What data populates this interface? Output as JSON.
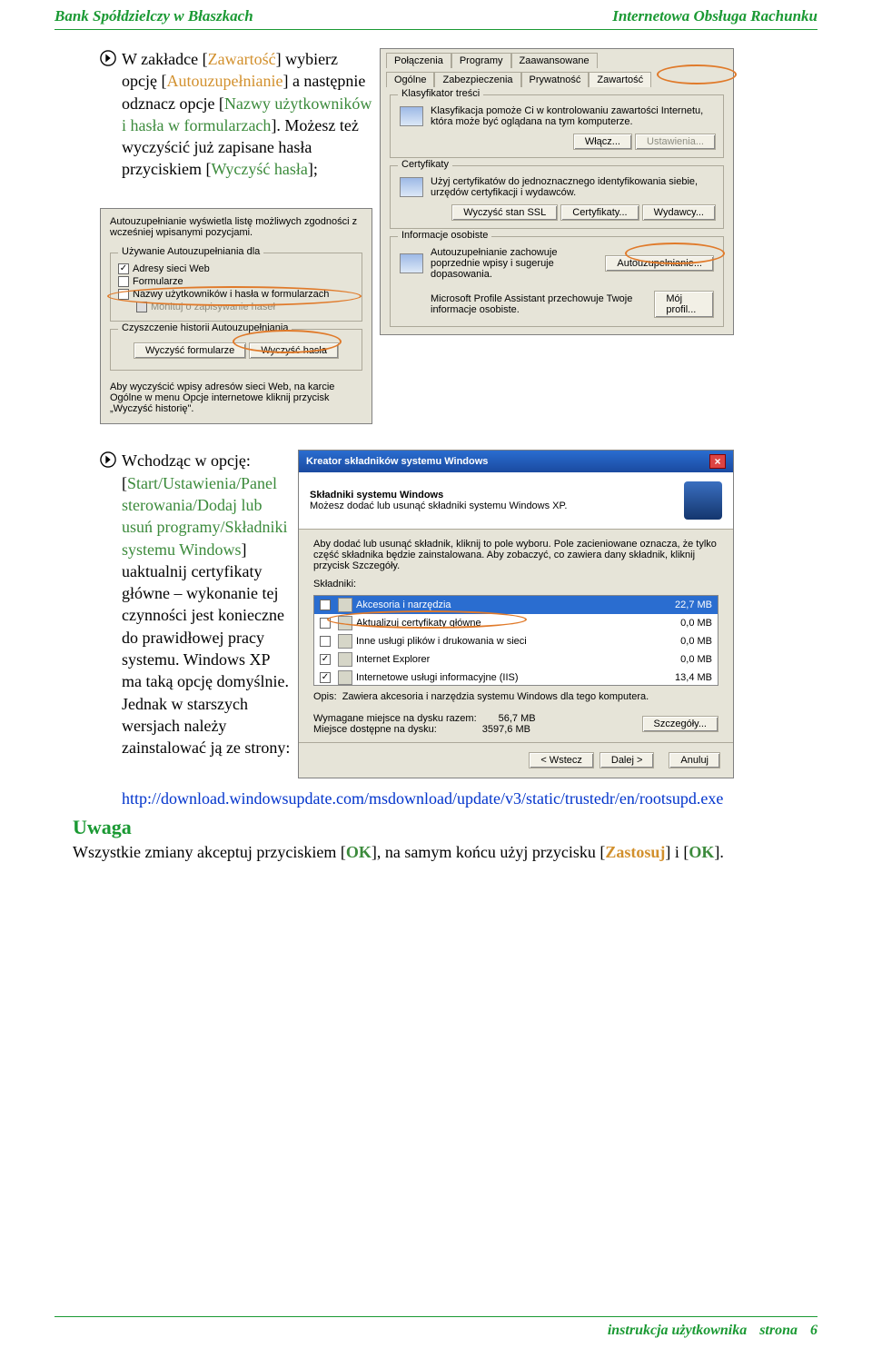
{
  "header": {
    "left": "Bank Spółdzielczy w Błaszkach",
    "right": "Internetowa Obsługa Rachunku"
  },
  "bullet1": {
    "parts": [
      {
        "t": "W zakładce [",
        "c": "#000"
      },
      {
        "t": "Zawartość",
        "c": "#d2902d"
      },
      {
        "t": "] wybierz opcję [",
        "c": "#000"
      },
      {
        "t": "Autouzupełnianie",
        "c": "#d2902d"
      },
      {
        "t": "] a następnie odznacz opcje [",
        "c": "#000"
      },
      {
        "t": "Nazwy użytkowników i hasła w formularzach",
        "c": "#3b8a3b"
      },
      {
        "t": "]. Możesz też wyczyścić już zapisane hasła przyciskiem [",
        "c": "#000"
      },
      {
        "t": "Wyczyść hasła",
        "c": "#3b8a3b"
      },
      {
        "t": "];",
        "c": "#000"
      }
    ]
  },
  "win1": {
    "tabs_bottom": [
      "Ogólne",
      "Zabezpieczenia",
      "Prywatność",
      "Zawartość"
    ],
    "tabs_top": [
      "Połączenia",
      "Programy",
      "Zaawansowane"
    ],
    "group_klas": {
      "title": "Klasyfikator treści",
      "text": "Klasyfikacja pomoże Ci w kontrolowaniu zawartości Internetu, która może być oglądana na tym komputerze.",
      "btn1": "Włącz...",
      "btn2": "Ustawienia..."
    },
    "group_cert": {
      "title": "Certyfikaty",
      "text": "Użyj certyfikatów do jednoznacznego identyfikowania siebie, urzędów certyfikacji i wydawców.",
      "b1": "Wyczyść stan SSL",
      "b2": "Certyfikaty...",
      "b3": "Wydawcy..."
    },
    "group_info": {
      "title": "Informacje osobiste",
      "text1": "Autouzupełnianie zachowuje poprzednie wpisy i sugeruje dopasowania.",
      "btn1": "Autouzupełnianie...",
      "text2": "Microsoft Profile Assistant przechowuje Twoje informacje osobiste.",
      "btn2": "Mój profil..."
    }
  },
  "win2": {
    "intro": "Autouzupełnianie wyświetla listę możliwych zgodności z wcześniej wpisanymi pozycjami.",
    "group_use": {
      "title": "Używanie Autouzupełniania dla",
      "items": [
        "Adresy sieci Web",
        "Formularze",
        "Nazwy użytkowników i hasła w formularzach",
        "Monituj o zapisywanie haseł"
      ],
      "checked": [
        true,
        false,
        false,
        false
      ]
    },
    "group_clear": {
      "title": "Czyszczenie historii Autouzupełniania",
      "b1": "Wyczyść formularze",
      "b2": "Wyczyść hasła"
    },
    "note": "Aby wyczyścić wpisy adresów sieci Web, na karcie Ogólne w menu Opcje internetowe kliknij przycisk „Wyczyść historię\"."
  },
  "bullet2": {
    "parts": [
      {
        "t": "Wchodząc w opcję: [",
        "c": "#000"
      },
      {
        "t": "Start/Ustawienia/Panel sterowania/Dodaj lub usuń programy/Składniki systemu Windows",
        "c": "#3b8a3b"
      },
      {
        "t": "] uaktualnij certyfikaty główne – wykonanie tej czynności jest konieczne do prawidłowej pracy systemu. Windows XP ma taką opcję domyślnie. Jednak w starszych wersjach należy zainstalować ją ze strony:",
        "c": "#000"
      }
    ]
  },
  "win3": {
    "title": "Kreator składników systemu Windows",
    "banner_title": "Składniki systemu Windows",
    "banner_sub": "Możesz dodać lub usunąć składniki systemu Windows XP.",
    "instr": "Aby dodać lub usunąć składnik, kliknij to pole wyboru. Pole zacieniowane oznacza, że tylko część składnika będzie zainstalowana. Aby zobaczyć, co zawiera dany składnik, kliknij przycisk Szczegóły.",
    "list_label": "Składniki:",
    "items": [
      {
        "chk": "☑",
        "name": "Akcesoria i narzędzia",
        "size": "22,7 MB",
        "sel": true
      },
      {
        "chk": "☐",
        "name": "Aktualizuj certyfikaty główne",
        "size": "0,0 MB"
      },
      {
        "chk": "☐",
        "name": "Inne usługi plików i drukowania w sieci",
        "size": "0,0 MB"
      },
      {
        "chk": "☑",
        "name": "Internet Explorer",
        "size": "0,0 MB"
      },
      {
        "chk": "☑",
        "name": "Internetowe usługi informacyjne (IIS)",
        "size": "13,4 MB"
      }
    ],
    "opis_label": "Opis:",
    "opis_text": "Zawiera akcesoria i narzędzia systemu Windows dla tego komputera.",
    "req_label": "Wymagane miejsce na dysku razem:",
    "req_val": "56,7 MB",
    "avail_label": "Miejsce dostępne na dysku:",
    "avail_val": "3597,6 MB",
    "btn_details": "Szczegóły...",
    "btn_back": "< Wstecz",
    "btn_next": "Dalej >",
    "btn_cancel": "Anuluj"
  },
  "link": "http://download.windowsupdate.com/msdownload/update/v3/static/trustedr/en/rootsupd.exe",
  "uwaga": {
    "title": "Uwaga",
    "parts": [
      {
        "t": "Wszystkie zmiany akceptuj przyciskiem [",
        "c": "#000"
      },
      {
        "t": "OK",
        "c": "#3b8a3b",
        "b": true
      },
      {
        "t": "], na samym końcu użyj przycisku [",
        "c": "#000"
      },
      {
        "t": "Zastosuj",
        "c": "#d2902d",
        "b": true
      },
      {
        "t": "] i [",
        "c": "#000"
      },
      {
        "t": "OK",
        "c": "#3b8a3b",
        "b": true
      },
      {
        "t": "].",
        "c": "#000"
      }
    ]
  },
  "footer": {
    "a": "instrukcja użytkownika",
    "b": "strona",
    "n": "6"
  }
}
